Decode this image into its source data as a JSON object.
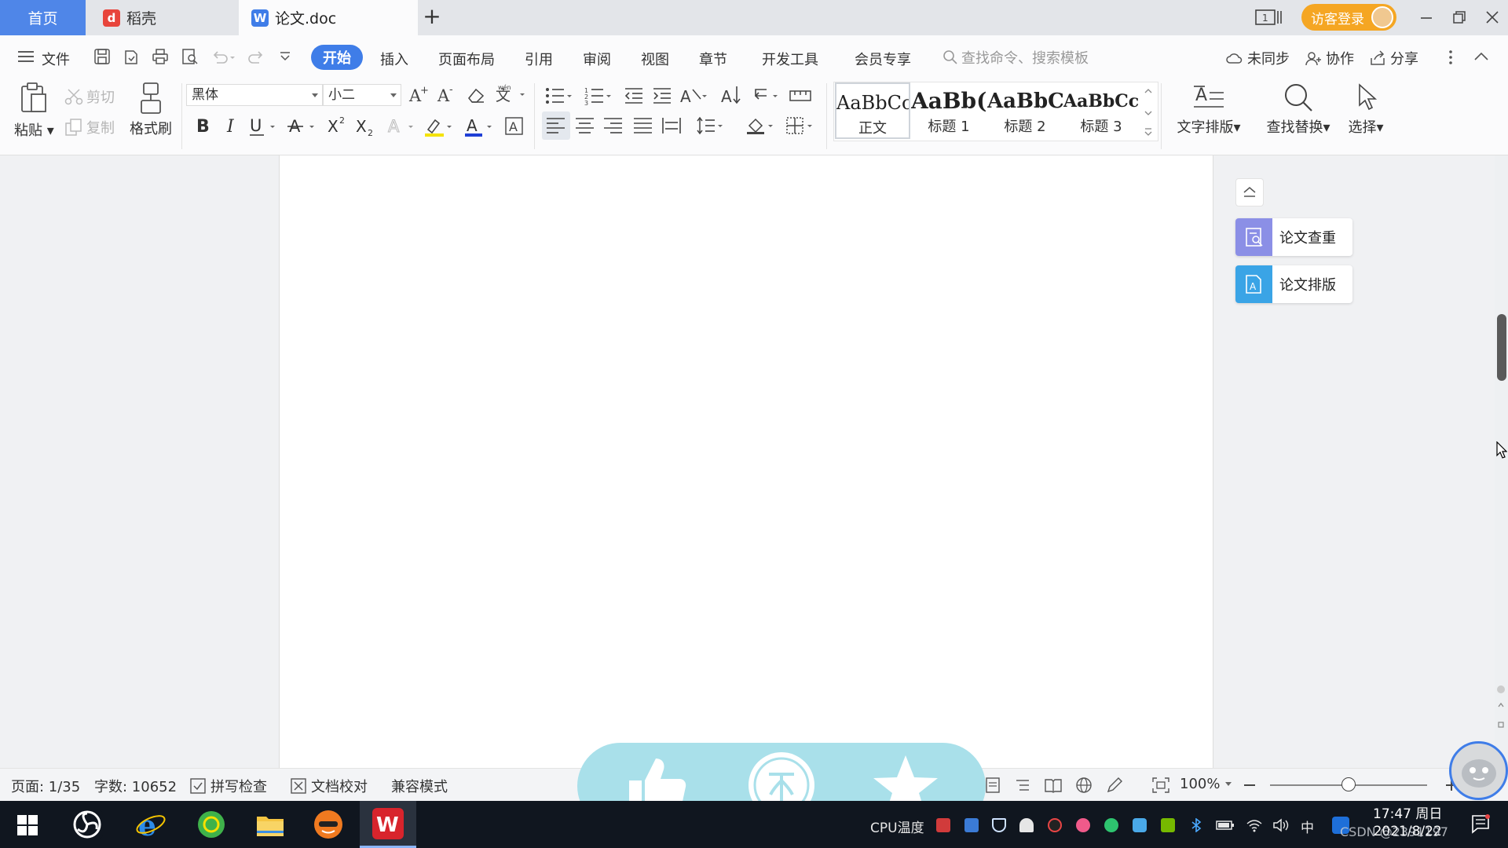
{
  "tabs": {
    "home": "首页",
    "daoke": "稻壳",
    "doc": "论文.doc",
    "add": "+"
  },
  "account": {
    "guest_label": "访客登录"
  },
  "menu": {
    "file": "文件",
    "tabs": [
      "开始",
      "插入",
      "页面布局",
      "引用",
      "审阅",
      "视图",
      "章节",
      "开发工具",
      "会员专享"
    ],
    "active_tab": "开始",
    "search_placeholder": "查找命令、搜索模板",
    "unsynced": "未同步",
    "collaborate": "协作",
    "share": "分享"
  },
  "ribbon": {
    "clipboard": {
      "paste": "粘贴",
      "cut": "剪切",
      "copy": "复制",
      "format_painter": "格式刷"
    },
    "font": {
      "name": "黑体",
      "size": "小二"
    },
    "styles": [
      {
        "sample": "AaBbCcI",
        "name": "正文"
      },
      {
        "sample": "AaBb(",
        "name": "标题 1"
      },
      {
        "sample": "AaBbC",
        "name": "标题 2"
      },
      {
        "sample": "AaBbCcl",
        "name": "标题 3"
      }
    ],
    "text_layout": "文字排版",
    "find_replace": "查找替换",
    "select": "选择"
  },
  "side_panel": {
    "plagiarism": "论文查重",
    "layout": "论文排版"
  },
  "status": {
    "page": "页面: 1/35",
    "words": "字数: 10652",
    "spell": "拼写检查",
    "proofread": "文档校对",
    "compat": "兼容模式",
    "zoom": "100%",
    "zoom_level": 0.5
  },
  "taskbar": {
    "cpu_label": "CPU温度",
    "ime": "中",
    "time": "17:47 周日",
    "date": "2021/8/22",
    "watermark": "CSDN @2391197"
  },
  "colors": {
    "accent": "#3f7de8",
    "home_tab": "#4f86e8",
    "guest": "#f5a623",
    "overlay": "#a9e0ea"
  }
}
